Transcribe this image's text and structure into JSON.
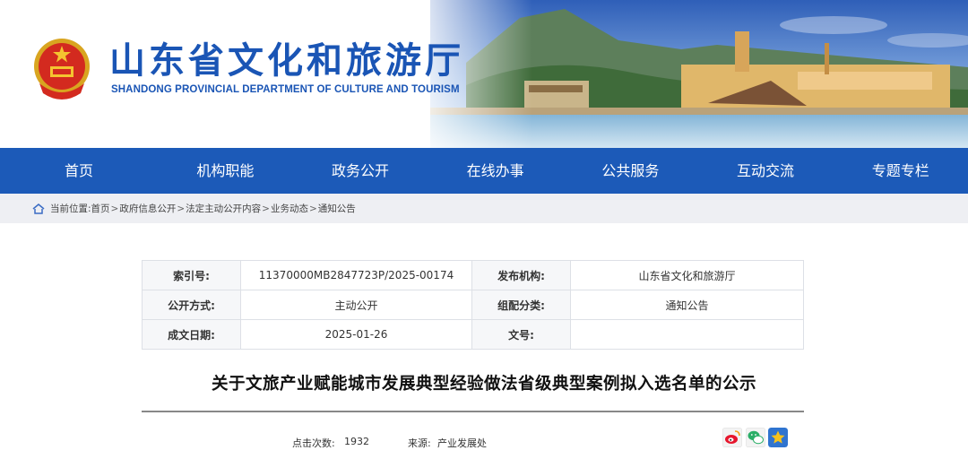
{
  "header": {
    "title": "山东省文化和旅游厅",
    "subtitle": "SHANDONG PROVINCIAL DEPARTMENT OF CULTURE AND  TOURISM"
  },
  "nav": {
    "items": [
      "首页",
      "机构职能",
      "政务公开",
      "在线办事",
      "公共服务",
      "互动交流",
      "专题专栏"
    ]
  },
  "breadcrumb": {
    "prefix": "当前位置:",
    "items": [
      "首页",
      "政府信息公开",
      "法定主动公开内容",
      "业务动态",
      "通知公告"
    ],
    "separator": ">"
  },
  "meta": {
    "index_label": "索引号:",
    "index_value": "11370000MB2847723P/2025-00174",
    "publisher_label": "发布机构:",
    "publisher_value": "山东省文化和旅游厅",
    "open_mode_label": "公开方式:",
    "open_mode_value": "主动公开",
    "category_label": "组配分类:",
    "category_value": "通知公告",
    "date_label": "成文日期:",
    "date_value": "2025-01-26",
    "docno_label": "文号:",
    "docno_value": ""
  },
  "article": {
    "title": "关于文旅产业赋能城市发展典型经验做法省级典型案例拟入选名单的公示",
    "clicks_label": "点击次数:",
    "clicks_value": "1932",
    "source_label": "来源:",
    "source_value": "产业发展处"
  },
  "share": {
    "icons": [
      "weibo-icon",
      "wechat-icon",
      "favorite-star-icon"
    ]
  },
  "colors": {
    "brand_blue": "#1c5ab8",
    "title_blue": "#1a55b5",
    "crumb_bg": "#eeeff3"
  }
}
